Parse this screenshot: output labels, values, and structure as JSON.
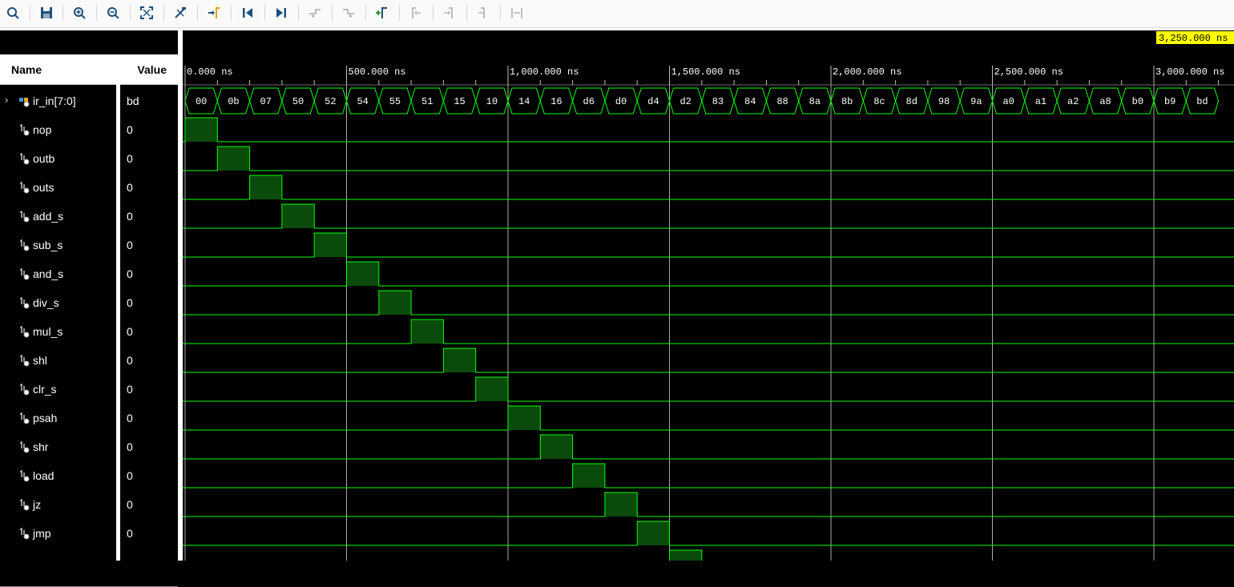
{
  "toolbar": {
    "buttons": [
      {
        "name": "search-button",
        "icon": "search-icon"
      },
      {
        "name": "save-button",
        "icon": "save-icon"
      },
      {
        "name": "zoom-in-button",
        "icon": "zoom-in-icon"
      },
      {
        "name": "zoom-out-button",
        "icon": "zoom-out-icon"
      },
      {
        "name": "zoom-fit-button",
        "icon": "zoom-fit-icon"
      },
      {
        "name": "zoom-cursor-button",
        "icon": "cursor-icon"
      },
      {
        "name": "go-to-cursor-button",
        "icon": "go-to-cursor-icon"
      },
      {
        "name": "go-to-start-button",
        "icon": "go-to-start-icon"
      },
      {
        "name": "go-to-end-button",
        "icon": "go-to-end-icon"
      },
      {
        "name": "previous-transition-button",
        "icon": "previous-transition-icon"
      },
      {
        "name": "next-transition-button",
        "icon": "next-transition-icon"
      },
      {
        "name": "add-marker-button",
        "icon": "add-marker-icon"
      },
      {
        "name": "previous-marker-button",
        "icon": "previous-marker-icon"
      },
      {
        "name": "next-marker-button",
        "icon": "next-marker-icon"
      },
      {
        "name": "swap-cursors-button",
        "icon": "swap-cursors-icon"
      },
      {
        "name": "fix-cursor-button",
        "icon": "fix-cursor-icon"
      }
    ]
  },
  "columns": {
    "name": "Name",
    "value": "Value"
  },
  "cursor": {
    "label": "3,250.000 ns",
    "time_ns": 3250,
    "color": "#ffff00"
  },
  "timeline": {
    "start_ns": 0,
    "labels": [
      "0.000 ns",
      "500.000 ns",
      "1,000.000 ns",
      "1,500.000 ns",
      "2,000.000 ns",
      "2,500.000 ns",
      "3,000.000 ns"
    ],
    "major_ns": [
      0,
      500,
      1000,
      1500,
      2000,
      2500,
      3000
    ]
  },
  "bus": {
    "name": "ir_in[7:0]",
    "value": "bd",
    "icon": "bus-icon",
    "values": [
      "00",
      "0b",
      "07",
      "50",
      "52",
      "54",
      "55",
      "51",
      "15",
      "10",
      "14",
      "16",
      "d6",
      "d0",
      "d4",
      "d2",
      "83",
      "84",
      "88",
      "8a",
      "8b",
      "8c",
      "8d",
      "98",
      "9a",
      "a0",
      "a1",
      "a2",
      "a8",
      "b0",
      "b9",
      "bd"
    ]
  },
  "signals": [
    {
      "name": "nop",
      "value": "0",
      "high_slot": 0
    },
    {
      "name": "outb",
      "value": "0",
      "high_slot": 1
    },
    {
      "name": "outs",
      "value": "0",
      "high_slot": 2
    },
    {
      "name": "add_s",
      "value": "0",
      "high_slot": 3
    },
    {
      "name": "sub_s",
      "value": "0",
      "high_slot": 4
    },
    {
      "name": "and_s",
      "value": "0",
      "high_slot": 5
    },
    {
      "name": "div_s",
      "value": "0",
      "high_slot": 6
    },
    {
      "name": "mul_s",
      "value": "0",
      "high_slot": 7
    },
    {
      "name": "shl",
      "value": "0",
      "high_slot": 8
    },
    {
      "name": "clr_s",
      "value": "0",
      "high_slot": 9
    },
    {
      "name": "psah",
      "value": "0",
      "high_slot": 10
    },
    {
      "name": "shr",
      "value": "0",
      "high_slot": 11
    },
    {
      "name": "load",
      "value": "0",
      "high_slot": 12
    },
    {
      "name": "jz",
      "value": "0",
      "high_slot": 13
    },
    {
      "name": "jmp",
      "value": "0",
      "high_slot": 14
    },
    {
      "name": "",
      "value": "",
      "high_slot": 15
    }
  ],
  "colors": {
    "wave": "#00ff00",
    "fill": "#0a4a0a",
    "grid": "#aaaaaa",
    "background": "#000000",
    "text": "#ffffff"
  }
}
